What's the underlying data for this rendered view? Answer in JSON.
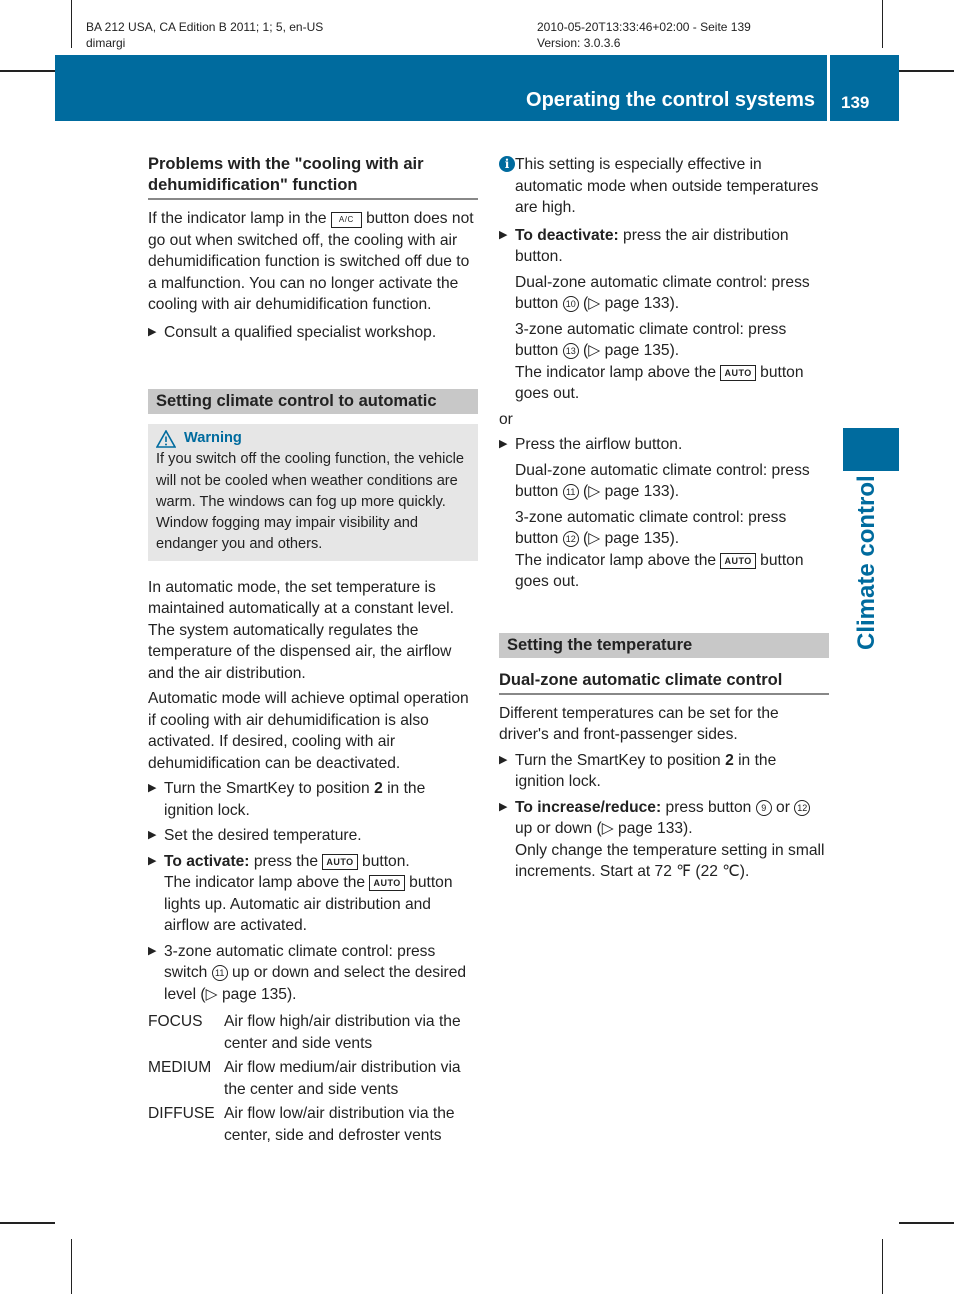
{
  "meta": {
    "left_line1": "BA 212 USA, CA Edition B 2011; 1; 5, en-US",
    "left_line2": "dimargi",
    "right_line1": "2010-05-20T13:33:46+02:00 - Seite 139",
    "right_line2": "Version: 3.0.3.6"
  },
  "header": {
    "title": "Operating the control systems",
    "page_number": "139",
    "accent_color": "#006b9e"
  },
  "side_tab": {
    "label": "Climate control"
  },
  "left": {
    "problems_heading": "Problems with the \"cooling with air dehumidification\" function",
    "problems_p_pre": "If the indicator lamp in the",
    "ac_button": "A/C",
    "problems_p_post": "button does not go out when switched off, the cooling with air dehumidification function is switched off due to a malfunction. You can no longer activate the cooling with air dehumidification function.",
    "consult_step": "Consult a qualified specialist workshop.",
    "section_title": "Setting climate control to automatic",
    "warning_title": "Warning",
    "warning_text": "If you switch off the cooling function, the vehicle will not be cooled when weather conditions are warm. The windows can fog up more quickly. Window fogging may impair visibility and endanger you and others.",
    "para1": "In automatic mode, the set temperature is maintained automatically at a constant level. The system automatically regulates the temperature of the dispensed air, the airflow and the air distribution.",
    "para2": "Automatic mode will achieve optimal operation if cooling with air dehumidification is also activated. If desired, cooling with air dehumidification can be deactivated.",
    "step1_pre": "Turn the SmartKey to position",
    "step1_bold": "2",
    "step1_post": "in the ignition lock.",
    "step2": "Set the desired temperature.",
    "step3_bold": "To activate:",
    "step3_pre": "press the",
    "auto_button": "AUTO",
    "step3_post": "button.",
    "step3_sub_pre": "The indicator lamp above the",
    "step3_sub_post": "button lights up. Automatic air distribution and airflow are activated.",
    "step4_pre": "3-zone automatic climate control: press switch",
    "step4_num": "11",
    "step4_post": "up or down and select the desired level (",
    "step4_ref": "page 135).",
    "levels": [
      {
        "term": "FOCUS",
        "desc": "Air flow high/air distribution via the center and side vents"
      },
      {
        "term": "MEDIUM",
        "desc": "Air flow medium/air distribution via the center and side vents"
      },
      {
        "term": "DIFFUSE",
        "desc": "Air flow low/air distribution via the center, side and defroster vents"
      }
    ]
  },
  "right": {
    "info_text": "This setting is especially effective in automatic mode when outside temperatures are high.",
    "deact_bold": "To deactivate:",
    "deact_text": "press the air distribution button.",
    "deact_dual_pre": "Dual-zone automatic climate control: press button",
    "deact_dual_num": "10",
    "deact_dual_ref": "page 133).",
    "deact_3zone_pre": "3-zone automatic climate control: press button",
    "deact_3zone_num": "13",
    "deact_3zone_ref": "page 135).",
    "lamp_pre": "The indicator lamp above the",
    "auto_button": "AUTO",
    "lamp_post": "button goes out.",
    "or": "or",
    "airflow_step": "Press the airflow button.",
    "air_dual_pre": "Dual-zone automatic climate control: press button",
    "air_dual_num": "11",
    "air_dual_ref": "page 133).",
    "air_3zone_pre": "3-zone automatic climate control: press button",
    "air_3zone_num": "12",
    "air_3zone_ref": "page 135).",
    "section_title": "Setting the temperature",
    "sub_heading": "Dual-zone automatic climate control",
    "temp_para": "Different temperatures can be set for the driver's and front-passenger sides.",
    "temp_step1_pre": "Turn the SmartKey to position",
    "temp_step1_bold": "2",
    "temp_step1_post": "in the ignition lock.",
    "temp_step2_bold": "To increase/reduce:",
    "temp_step2_pre": "press button",
    "temp_step2_num1": "9",
    "temp_step2_or": "or",
    "temp_step2_num2": "12",
    "temp_step2_post": "up or down (",
    "temp_step2_ref": "page 133).",
    "temp_note": "Only change the temperature setting in small increments. Start at 72 ℉ (22 ℃)."
  }
}
